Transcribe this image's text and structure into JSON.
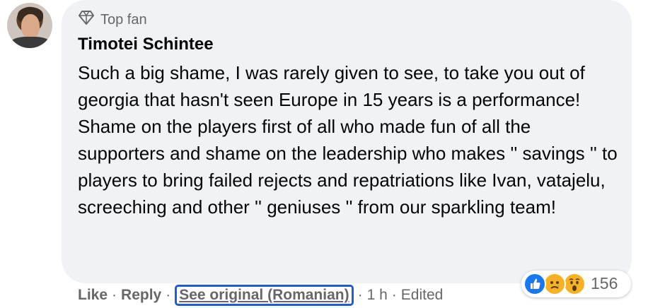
{
  "comment": {
    "badge_icon": "diamond-icon",
    "badge_label": "Top fan",
    "author": "Timotei Schintee",
    "text": "Such a big shame, I was rarely given to see, to take you out of georgia that hasn't seen Europe in 15 years is a performance! Shame on the players first of all who made fun of all the supporters and shame on the leadership who makes '' savings '' to players to bring failed rejects and repatriations like Ivan, vatajelu, screeching and other '' geniuses '' from our sparkling team!"
  },
  "actions": {
    "like": "Like",
    "reply": "Reply",
    "see_original": "See original (Romanian)",
    "time": "1 h",
    "edited": "Edited",
    "separator": "·"
  },
  "reactions": {
    "icons": [
      "like-icon",
      "sad-icon",
      "wow-icon"
    ],
    "count": "156",
    "colors": {
      "like": "#1877f2",
      "emoji": "#f7b125"
    }
  },
  "colors": {
    "bubble": "#f0f2f5",
    "secondary_text": "#65676b",
    "primary_text": "#050505",
    "focus_ring": "#1d5fd0"
  }
}
